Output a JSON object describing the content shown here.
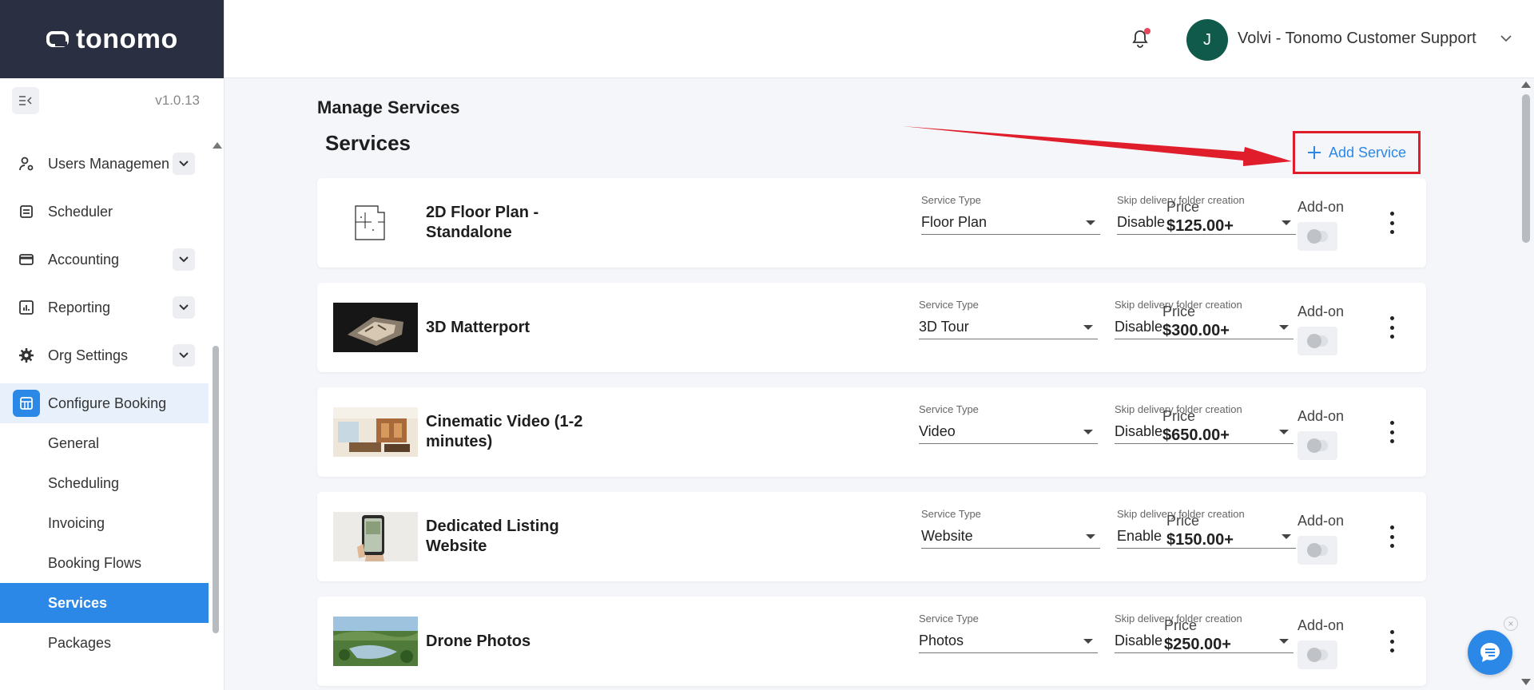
{
  "brand": {
    "name": "tonomo",
    "version": "v1.0.13"
  },
  "header": {
    "user_initial": "J",
    "user_name": "Volvi - Tonomo Customer Support"
  },
  "sidebar": {
    "items": [
      {
        "label": "Users Managemen",
        "icon": "users-gear-icon",
        "has_chevron": true
      },
      {
        "label": "Scheduler",
        "icon": "scheduler-icon",
        "has_chevron": false
      },
      {
        "label": "Accounting",
        "icon": "wallet-icon",
        "has_chevron": true
      },
      {
        "label": "Reporting",
        "icon": "bar-chart-icon",
        "has_chevron": true
      },
      {
        "label": "Org Settings",
        "icon": "gear-icon",
        "has_chevron": true
      },
      {
        "label": "Configure Booking",
        "icon": "booking-icon",
        "has_chevron": false
      }
    ],
    "sub_items": [
      "General",
      "Scheduling",
      "Invoicing",
      "Booking Flows",
      "Services",
      "Packages"
    ],
    "active_sub": "Services"
  },
  "main": {
    "page_title": "Manage Services",
    "section_title": "Services",
    "add_button": "Add Service",
    "labels": {
      "service_type": "Service Type",
      "skip_delivery": "Skip delivery folder creation",
      "price": "Price",
      "addon": "Add-on"
    },
    "services": [
      {
        "name": "2D Floor Plan - Standalone",
        "type": "Floor Plan",
        "skip": "Disable",
        "price": "$125.00+",
        "addon": false
      },
      {
        "name": "3D Matterport",
        "type": "3D Tour",
        "skip": "Disable",
        "price": "$300.00+",
        "addon": false
      },
      {
        "name": "Cinematic Video (1-2 minutes)",
        "type": "Video",
        "skip": "Disable",
        "price": "$650.00+",
        "addon": false
      },
      {
        "name": "Dedicated Listing Website",
        "type": "Website",
        "skip": "Enable",
        "price": "$150.00+",
        "addon": false
      },
      {
        "name": "Drone Photos",
        "type": "Photos",
        "skip": "Disable",
        "price": "$250.00+",
        "addon": false
      }
    ]
  },
  "colors": {
    "accent": "#2b88e6",
    "sidebar_header": "#2a3041",
    "highlight": "#e01e2b"
  }
}
